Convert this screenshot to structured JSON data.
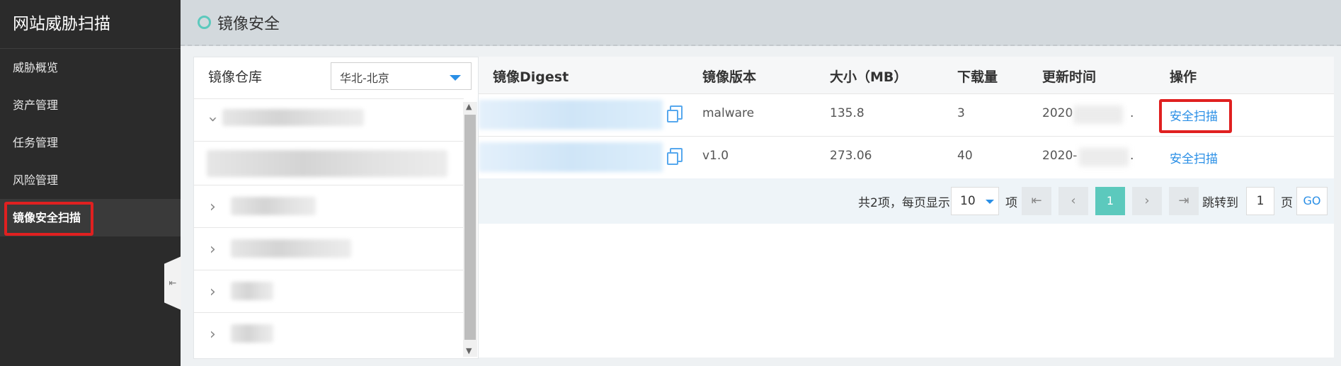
{
  "sidebar": {
    "brand": "网站威胁扫描",
    "items": [
      {
        "label": "威胁概览"
      },
      {
        "label": "资产管理"
      },
      {
        "label": "任务管理"
      },
      {
        "label": "风险管理"
      },
      {
        "label": "镜像安全扫描",
        "active": true
      }
    ],
    "collapse_icon": "collapse-left-icon"
  },
  "header": {
    "title": "镜像安全"
  },
  "left_panel": {
    "repo_label": "镜像仓库",
    "region": "华北-北京"
  },
  "table": {
    "headers": [
      "镜像Digest",
      "镜像版本",
      "大小（MB）",
      "下载量",
      "更新时间",
      "操作"
    ],
    "rows": [
      {
        "version": "malware",
        "size": "135.8",
        "downloads": "3",
        "updated": "2020",
        "updated_tail": ".",
        "action": "安全扫描"
      },
      {
        "version": "v1.0",
        "size": "273.06",
        "downloads": "40",
        "updated": "2020-",
        "updated_tail": ".",
        "action": "安全扫描"
      }
    ]
  },
  "pagination": {
    "total_text": "共2项，每页显示",
    "page_size": "10",
    "unit": "项",
    "first_icon": "first-page-icon",
    "prev_icon": "prev-page-icon",
    "current_page": "1",
    "next_icon": "next-page-icon",
    "last_icon": "last-page-icon",
    "jump_label": "跳转到",
    "jump_value": "1",
    "page_label": "页",
    "go_label": "GO"
  },
  "colors": {
    "sidebar_bg": "#2b2b2b",
    "accent_teal": "#5cc9bd",
    "link_blue": "#2a8fe6",
    "highlight_red": "#e02020"
  }
}
